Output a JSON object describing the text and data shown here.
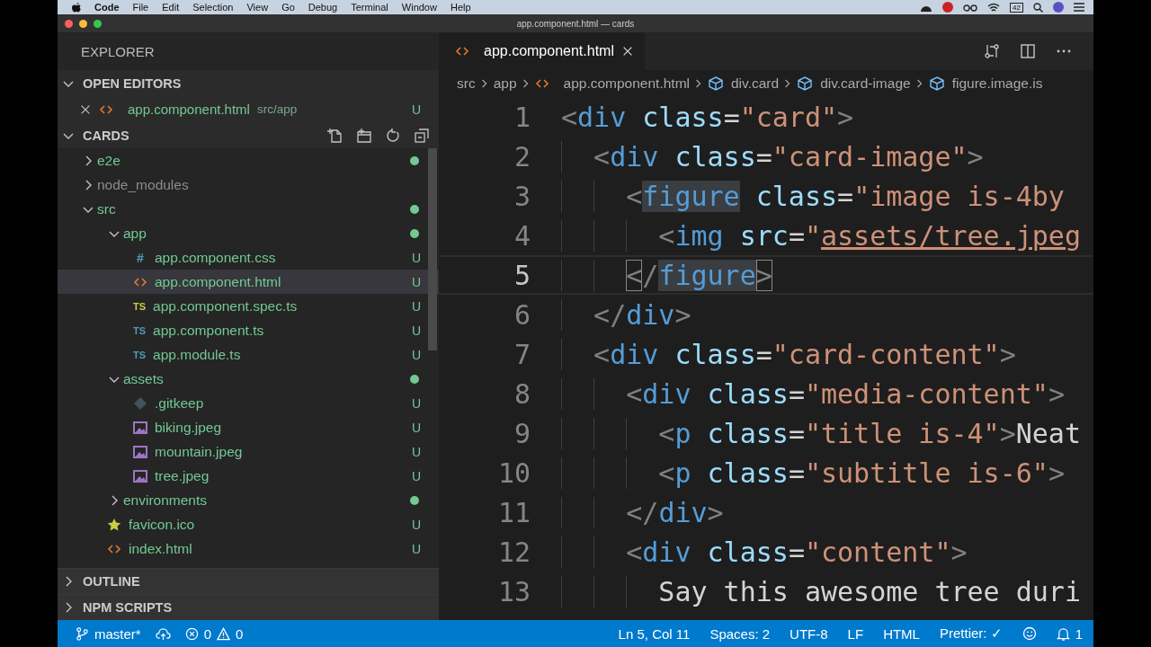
{
  "menubar": {
    "app_name": "Code",
    "menus": [
      "File",
      "Edit",
      "Selection",
      "View",
      "Go",
      "Debug",
      "Terminal",
      "Window",
      "Help"
    ],
    "battery": "42"
  },
  "window": {
    "title": "app.component.html — cards"
  },
  "sidebar": {
    "title": "EXPLORER",
    "open_editors": {
      "label": "OPEN EDITORS",
      "expanded": true,
      "items": [
        {
          "name": "app.component.html",
          "path": "src/app",
          "badge": "U",
          "kind": "html"
        }
      ]
    },
    "folder": {
      "label": "CARDS",
      "expanded": true,
      "tree": [
        {
          "name": "e2e",
          "kind": "folder",
          "expanded": false,
          "ignored": false,
          "dot": true,
          "selected": false
        },
        {
          "name": "node_modules",
          "kind": "folder",
          "expanded": false,
          "ignored": true,
          "dot": false,
          "selected": false
        },
        {
          "name": "src",
          "kind": "folder",
          "expanded": true,
          "ignored": false,
          "dot": true,
          "selected": false,
          "children": [
            {
              "name": "app",
              "kind": "folder",
              "expanded": true,
              "ignored": false,
              "dot": true,
              "selected": false,
              "children": [
                {
                  "name": "app.component.css",
                  "kind": "css",
                  "icon_text": "#",
                  "ignored": false,
                  "badge": "U",
                  "selected": false
                },
                {
                  "name": "app.component.html",
                  "kind": "html",
                  "ignored": false,
                  "badge": "U",
                  "selected": true
                },
                {
                  "name": "app.component.spec.ts",
                  "kind": "spec",
                  "icon_text": "TS",
                  "ignored": false,
                  "badge": "U",
                  "selected": false
                },
                {
                  "name": "app.component.ts",
                  "kind": "ts",
                  "icon_text": "TS",
                  "ignored": false,
                  "badge": "U",
                  "selected": false
                },
                {
                  "name": "app.module.ts",
                  "kind": "ts",
                  "icon_text": "TS",
                  "ignored": false,
                  "badge": "U",
                  "selected": false
                }
              ]
            },
            {
              "name": "assets",
              "kind": "folder",
              "expanded": true,
              "ignored": false,
              "dot": true,
              "selected": false,
              "children": [
                {
                  "name": ".gitkeep",
                  "kind": "git",
                  "ignored": false,
                  "badge": "U",
                  "selected": false
                },
                {
                  "name": "biking.jpeg",
                  "kind": "image",
                  "ignored": false,
                  "badge": "U",
                  "selected": false
                },
                {
                  "name": "mountain.jpeg",
                  "kind": "image",
                  "ignored": false,
                  "badge": "U",
                  "selected": false
                },
                {
                  "name": "tree.jpeg",
                  "kind": "image",
                  "ignored": false,
                  "badge": "U",
                  "selected": false
                }
              ]
            },
            {
              "name": "environments",
              "kind": "folder",
              "expanded": false,
              "ignored": false,
              "dot": true,
              "selected": false
            },
            {
              "name": "favicon.ico",
              "kind": "star",
              "ignored": false,
              "badge": "U",
              "selected": false
            },
            {
              "name": "index.html",
              "kind": "html",
              "ignored": false,
              "badge": "U",
              "selected": false
            }
          ]
        }
      ]
    },
    "footer_sections": [
      {
        "label": "OUTLINE",
        "expanded": false
      },
      {
        "label": "NPM SCRIPTS",
        "expanded": false
      }
    ]
  },
  "editor": {
    "tabs": [
      {
        "label": "app.component.html",
        "selected": true
      }
    ],
    "breadcrumbs": [
      {
        "kind": "folder",
        "label": "src"
      },
      {
        "kind": "folder",
        "label": "app"
      },
      {
        "kind": "html",
        "label": "app.component.html"
      },
      {
        "kind": "element",
        "label": "div.card"
      },
      {
        "kind": "element",
        "label": "div.card-image"
      },
      {
        "kind": "element",
        "label": "figure.image.is"
      }
    ],
    "lines": [
      {
        "number": "1",
        "current": false,
        "tokens": [
          {
            "kind": "bracket",
            "text": "<"
          },
          {
            "kind": "tag",
            "text": "div"
          },
          {
            "kind": "attr",
            "text": " class"
          },
          {
            "kind": "eq",
            "text": "="
          },
          {
            "kind": "string",
            "text": "\"card\""
          },
          {
            "kind": "bracket",
            "text": ">"
          }
        ]
      },
      {
        "number": "2",
        "current": false,
        "tokens": [
          {
            "kind": "bracket",
            "text": "  <"
          },
          {
            "kind": "tag",
            "text": "div"
          },
          {
            "kind": "attr",
            "text": " class"
          },
          {
            "kind": "eq",
            "text": "="
          },
          {
            "kind": "string",
            "text": "\"card-image\""
          },
          {
            "kind": "bracket",
            "text": ">"
          }
        ]
      },
      {
        "number": "3",
        "current": false,
        "tokens": [
          {
            "kind": "bracket",
            "text": "    <"
          },
          {
            "kind": "tag_match",
            "text": "figure"
          },
          {
            "kind": "attr",
            "text": " class"
          },
          {
            "kind": "eq",
            "text": "="
          },
          {
            "kind": "string",
            "text": "\"image is-4by"
          }
        ]
      },
      {
        "number": "4",
        "current": false,
        "tokens": [
          {
            "kind": "bracket",
            "text": "      <"
          },
          {
            "kind": "tag",
            "text": "img"
          },
          {
            "kind": "attr",
            "text": " src"
          },
          {
            "kind": "eq",
            "text": "="
          },
          {
            "kind": "string",
            "text": "\""
          },
          {
            "kind": "link",
            "text": "assets/tree.jpeg"
          }
        ]
      },
      {
        "number": "5",
        "current": true,
        "tokens": [
          {
            "kind": "bracket_match",
            "text": "    <"
          },
          {
            "kind": "bracket",
            "text": "/"
          },
          {
            "kind": "tag_match",
            "text": "figure"
          },
          {
            "kind": "bracket_match",
            "text": ">"
          }
        ]
      },
      {
        "number": "6",
        "current": false,
        "tokens": [
          {
            "kind": "bracket",
            "text": "  </"
          },
          {
            "kind": "tag",
            "text": "div"
          },
          {
            "kind": "bracket",
            "text": ">"
          }
        ]
      },
      {
        "number": "7",
        "current": false,
        "tokens": [
          {
            "kind": "bracket",
            "text": "  <"
          },
          {
            "kind": "tag",
            "text": "div"
          },
          {
            "kind": "attr",
            "text": " class"
          },
          {
            "kind": "eq",
            "text": "="
          },
          {
            "kind": "string",
            "text": "\"card-content\""
          },
          {
            "kind": "bracket",
            "text": ">"
          }
        ]
      },
      {
        "number": "8",
        "current": false,
        "tokens": [
          {
            "kind": "bracket",
            "text": "    <"
          },
          {
            "kind": "tag",
            "text": "div"
          },
          {
            "kind": "attr",
            "text": " class"
          },
          {
            "kind": "eq",
            "text": "="
          },
          {
            "kind": "string",
            "text": "\"media-content\""
          },
          {
            "kind": "bracket",
            "text": ">"
          }
        ]
      },
      {
        "number": "9",
        "current": false,
        "tokens": [
          {
            "kind": "bracket",
            "text": "      <"
          },
          {
            "kind": "tag",
            "text": "p"
          },
          {
            "kind": "attr",
            "text": " class"
          },
          {
            "kind": "eq",
            "text": "="
          },
          {
            "kind": "string",
            "text": "\"title is-4\""
          },
          {
            "kind": "bracket",
            "text": ">"
          },
          {
            "kind": "text",
            "text": "Neat"
          }
        ]
      },
      {
        "number": "10",
        "current": false,
        "tokens": [
          {
            "kind": "bracket",
            "text": "      <"
          },
          {
            "kind": "tag",
            "text": "p"
          },
          {
            "kind": "attr",
            "text": " class"
          },
          {
            "kind": "eq",
            "text": "="
          },
          {
            "kind": "string",
            "text": "\"subtitle is-6\""
          },
          {
            "kind": "bracket",
            "text": ">"
          }
        ]
      },
      {
        "number": "11",
        "current": false,
        "tokens": [
          {
            "kind": "bracket",
            "text": "    </"
          },
          {
            "kind": "tag",
            "text": "div"
          },
          {
            "kind": "bracket",
            "text": ">"
          }
        ]
      },
      {
        "number": "12",
        "current": false,
        "tokens": [
          {
            "kind": "bracket",
            "text": "    <"
          },
          {
            "kind": "tag",
            "text": "div"
          },
          {
            "kind": "attr",
            "text": " class"
          },
          {
            "kind": "eq",
            "text": "="
          },
          {
            "kind": "string",
            "text": "\"content\""
          },
          {
            "kind": "bracket",
            "text": ">"
          }
        ]
      },
      {
        "number": "13",
        "current": false,
        "tokens": [
          {
            "kind": "text",
            "text": "      Say this awesome tree duri"
          }
        ]
      }
    ]
  },
  "status_bar": {
    "branch": "master*",
    "errors": "0",
    "warnings": "0",
    "items": [
      "Ln 5, Col 11",
      "Spaces: 2",
      "UTF-8",
      "LF",
      "HTML",
      "Prettier: ✓"
    ],
    "notifications": "1"
  }
}
